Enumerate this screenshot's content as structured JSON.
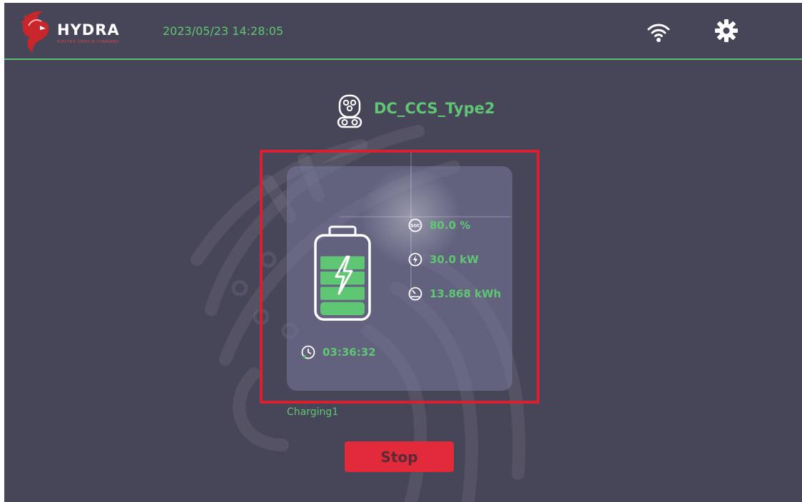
{
  "header": {
    "logo_text": "HYDRA",
    "logo_subtext": "ELECTRIC VEHICLE CHARGERS",
    "datetime": "2023/05/23 14:28:05",
    "wifi_icon": "wifi-icon",
    "settings_icon": "gear-icon"
  },
  "connector": {
    "icon": "ccs-connector-icon",
    "name": "DC_CCS_Type2"
  },
  "session": {
    "soc": "80.0 %",
    "power": "30.0 kW",
    "energy": "13.868 kWh",
    "elapsed": "03:36:32",
    "status": "Charging1",
    "battery_fill_segments": 4,
    "battery_total_segments": 5
  },
  "actions": {
    "stop_label": "Stop"
  },
  "colors": {
    "background": "#474558",
    "accent_green": "#5fc773",
    "stop_red": "#e32a3a",
    "frame_red": "#d9202f"
  }
}
